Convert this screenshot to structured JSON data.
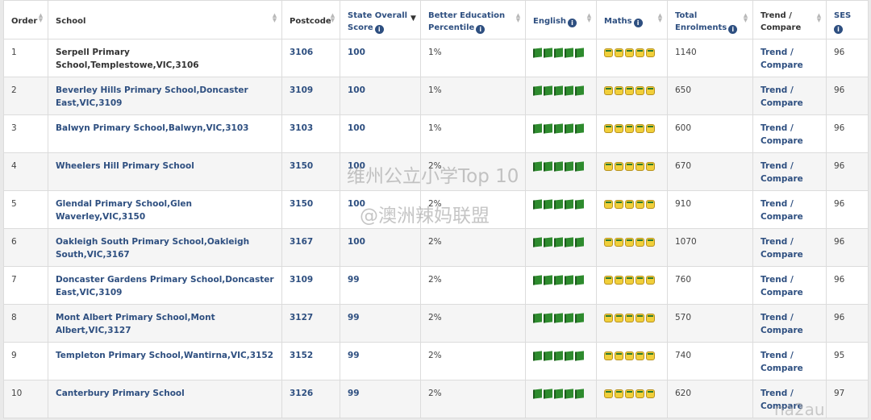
{
  "headers": {
    "order": "Order",
    "school": "School",
    "postcode": "Postcode",
    "state_score_line1": "State Overall",
    "state_score_line2": "Score",
    "percentile_line1": "Better Education",
    "percentile_line2": "Percentile",
    "english": "English",
    "maths": "Maths",
    "enrolments_line1": "Total",
    "enrolments_line2": "Enrolments",
    "trend_line1": "Trend /",
    "trend_line2": "Compare",
    "ses": "SES"
  },
  "icons": {
    "info": "info-icon",
    "english": "book-icon",
    "maths": "coin-icon",
    "sort": "sort-icon",
    "sort_active": "sort-descending-icon"
  },
  "colors": {
    "link": "#2e4f80",
    "english_icon": "#2e8b2e",
    "maths_icon": "#f1cf3a"
  },
  "rows": [
    {
      "order": "1",
      "school": "Serpell Primary School,Templestowe,VIC,3106",
      "postcode": "3106",
      "score": "100",
      "percentile": "1%",
      "english_rating": 5,
      "maths_rating": 5,
      "enrolments": "1140",
      "trend": "Trend / Compare",
      "ses": "96"
    },
    {
      "order": "2",
      "school": "Beverley Hills Primary School,Doncaster East,VIC,3109",
      "postcode": "3109",
      "score": "100",
      "percentile": "1%",
      "english_rating": 5,
      "maths_rating": 5,
      "enrolments": "650",
      "trend": "Trend / Compare",
      "ses": "96"
    },
    {
      "order": "3",
      "school": "Balwyn Primary School,Balwyn,VIC,3103",
      "postcode": "3103",
      "score": "100",
      "percentile": "1%",
      "english_rating": 5,
      "maths_rating": 5,
      "enrolments": "600",
      "trend": "Trend / Compare",
      "ses": "96"
    },
    {
      "order": "4",
      "school": "Wheelers Hill Primary School",
      "postcode": "3150",
      "score": "100",
      "percentile": "2%",
      "english_rating": 5,
      "maths_rating": 5,
      "enrolments": "670",
      "trend": "Trend / Compare",
      "ses": "96"
    },
    {
      "order": "5",
      "school": "Glendal Primary School,Glen Waverley,VIC,3150",
      "postcode": "3150",
      "score": "100",
      "percentile": "2%",
      "english_rating": 5,
      "maths_rating": 5,
      "enrolments": "910",
      "trend": "Trend / Compare",
      "ses": "96"
    },
    {
      "order": "6",
      "school": "Oakleigh South Primary School,Oakleigh South,VIC,3167",
      "postcode": "3167",
      "score": "100",
      "percentile": "2%",
      "english_rating": 5,
      "maths_rating": 5,
      "enrolments": "1070",
      "trend": "Trend / Compare",
      "ses": "96"
    },
    {
      "order": "7",
      "school": "Doncaster Gardens Primary School,Doncaster East,VIC,3109",
      "postcode": "3109",
      "score": "99",
      "percentile": "2%",
      "english_rating": 5,
      "maths_rating": 5,
      "enrolments": "760",
      "trend": "Trend / Compare",
      "ses": "96"
    },
    {
      "order": "8",
      "school": "Mont Albert Primary School,Mont Albert,VIC,3127",
      "postcode": "3127",
      "score": "99",
      "percentile": "2%",
      "english_rating": 5,
      "maths_rating": 5,
      "enrolments": "570",
      "trend": "Trend / Compare",
      "ses": "96"
    },
    {
      "order": "9",
      "school": "Templeton Primary School,Wantirna,VIC,3152",
      "postcode": "3152",
      "score": "99",
      "percentile": "2%",
      "english_rating": 5,
      "maths_rating": 5,
      "enrolments": "740",
      "trend": "Trend / Compare",
      "ses": "95"
    },
    {
      "order": "10",
      "school": "Canterbury Primary School",
      "postcode": "3126",
      "score": "99",
      "percentile": "2%",
      "english_rating": 5,
      "maths_rating": 5,
      "enrolments": "620",
      "trend": "Trend / Compare",
      "ses": "97"
    }
  ],
  "watermarks": {
    "title": "维州公立小学Top 10",
    "handle": "@澳洲辣妈联盟",
    "corner": "na2au"
  }
}
